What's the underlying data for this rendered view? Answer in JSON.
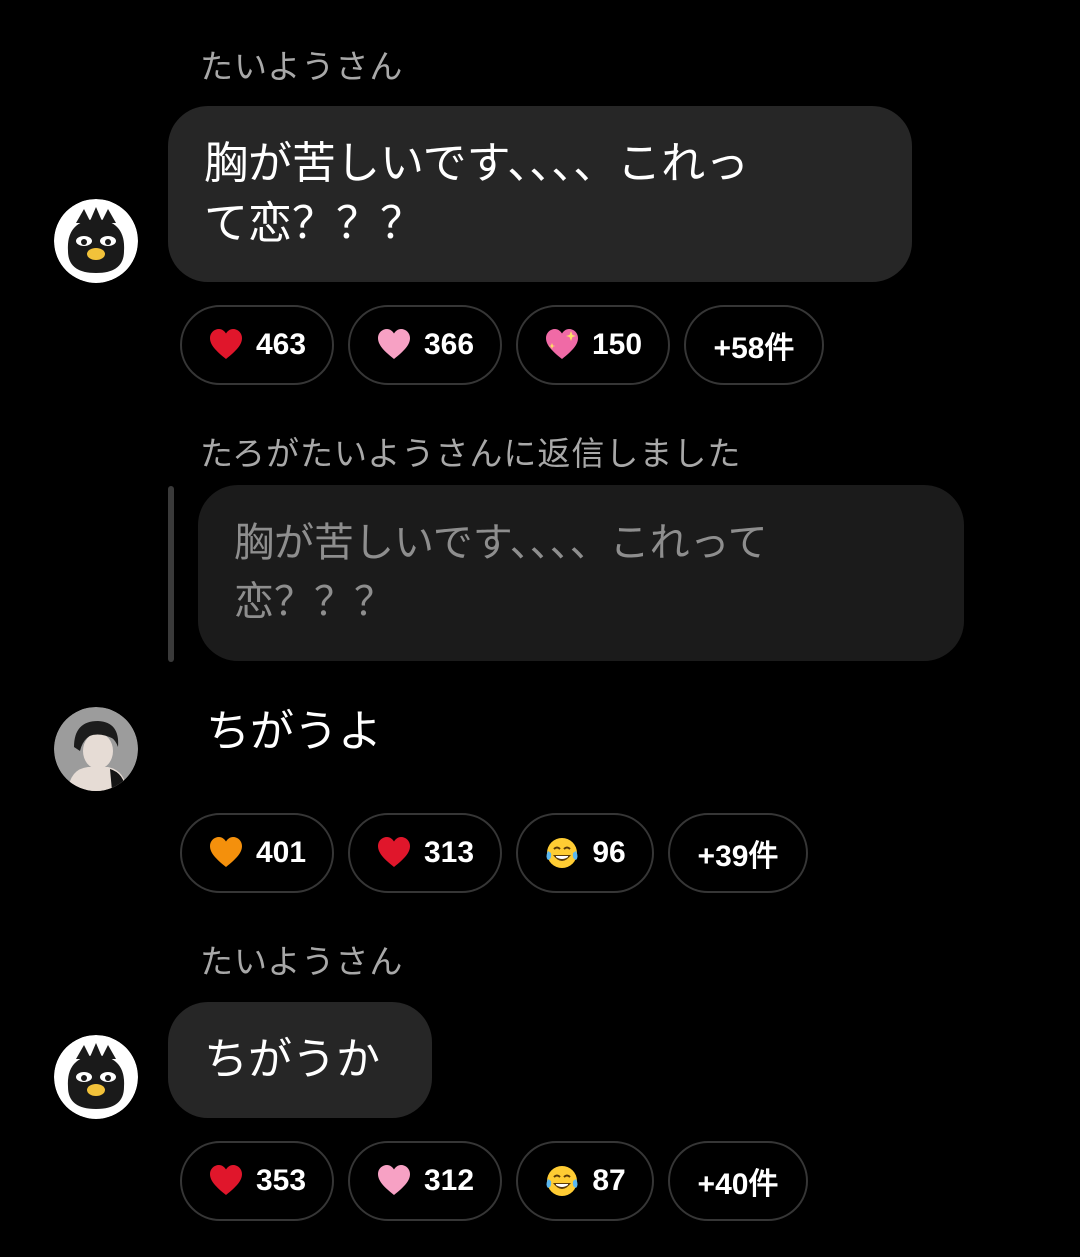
{
  "messages": [
    {
      "sender": "たいようさん",
      "text_line1": "胸が苦しいです、、、、これっ",
      "text_line2": "て恋？？？",
      "avatar": "penguin-avatar-icon",
      "reactions": [
        {
          "emoji": "red-heart-icon",
          "count": "463"
        },
        {
          "emoji": "pink-heart-icon",
          "count": "366"
        },
        {
          "emoji": "sparkling-heart-icon",
          "count": "150"
        }
      ],
      "more": "+58件"
    },
    {
      "reply_header": "たろがたいようさんに返信しました",
      "quoted_line1": "胸が苦しいです、、、、これって",
      "quoted_line2": "恋？？？",
      "text": "ちがうよ",
      "avatar": "person-photo-avatar",
      "reactions": [
        {
          "emoji": "orange-heart-icon",
          "count": "401"
        },
        {
          "emoji": "red-heart-icon",
          "count": "313"
        },
        {
          "emoji": "tears-of-joy-icon",
          "count": "96"
        }
      ],
      "more": "+39件"
    },
    {
      "sender": "たいようさん",
      "text": "ちがうか",
      "avatar": "penguin-avatar-icon",
      "reactions": [
        {
          "emoji": "red-heart-icon",
          "count": "353"
        },
        {
          "emoji": "pink-heart-icon",
          "count": "312"
        },
        {
          "emoji": "tears-of-joy-icon",
          "count": "87"
        }
      ],
      "more": "+40件"
    }
  ],
  "colors": {
    "background": "#000000",
    "bubble": "#262626",
    "quote_bubble": "#1b1b1b",
    "sender_text": "#a8a8a8",
    "quote_text": "#8e8e8e",
    "pill_border": "#363636"
  }
}
